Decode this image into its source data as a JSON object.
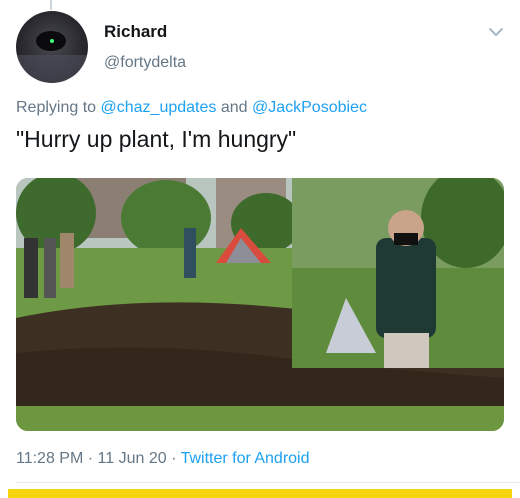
{
  "tweet": {
    "display_name": "Richard",
    "handle": "@fortydelta",
    "replying_prefix": "Replying to",
    "replying_to": [
      "@chaz_updates",
      "@JackPosobiec"
    ],
    "replying_joiner": "and",
    "text": "\"Hurry up plant, I'm hungry\"",
    "time": "11:28 PM",
    "date": "11 Jun 20",
    "source": "Twitter for Android",
    "separator": "·"
  },
  "icons": {
    "menu": "chevron-down-icon"
  },
  "colors": {
    "link": "#1da1f2",
    "secondary_text": "#657786",
    "primary_text": "#14171a",
    "bottom_bar": "#f5d40f"
  }
}
